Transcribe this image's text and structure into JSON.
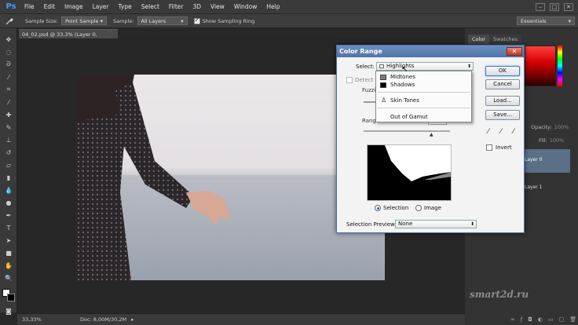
{
  "app": {
    "logo": "Ps",
    "menu": [
      "File",
      "Edit",
      "Image",
      "Layer",
      "Type",
      "Select",
      "Filter",
      "3D",
      "View",
      "Window",
      "Help"
    ],
    "window_controls": [
      "–",
      "□",
      "✕"
    ]
  },
  "options_bar": {
    "sample_size_label": "Sample Size:",
    "sample_size_value": "Point Sample",
    "sample_label": "Sample:",
    "sample_value": "All Layers",
    "sampling_ring_label": "Show Sampling Ring",
    "sampling_ring_checked": true,
    "workspace_value": "Essentials"
  },
  "document": {
    "tab_title": "04_02.psd @ 33,3% (Layer 0, RGB/8#) *",
    "tab_close": "×"
  },
  "status_bar": {
    "zoom": "33,33%",
    "doc_size": "Doc: 8,00M/30,2M"
  },
  "panels": {
    "tabs": [
      {
        "label": "Color",
        "active": true
      },
      {
        "label": "Swatches",
        "active": false
      }
    ],
    "opacity_label": "Opacity:",
    "opacity_value": "100%",
    "fill_label": "Fill:",
    "fill_value": "100%",
    "layers": [
      "Layer 0",
      "Layer 1"
    ]
  },
  "color_range": {
    "title": "Color Range",
    "close_glyph": "✕",
    "select_label": "Select:",
    "select_value": "Highlights",
    "detect_faces_label": "Detect F",
    "fuzziness_label": "Fuzzi",
    "range_label": "Range:",
    "range_value": "190",
    "selection_radio": "Selection",
    "image_radio": "Image",
    "selection_selected": true,
    "selection_preview_label": "Selection Preview:",
    "selection_preview_value": "None",
    "ok": "OK",
    "cancel": "Cancel",
    "load": "Load...",
    "save": "Save...",
    "invert_label": "Invert",
    "invert_checked": false,
    "dropdown": {
      "items": [
        {
          "label": "Midtones",
          "swatch": "#7a7a7a"
        },
        {
          "label": "Shadows",
          "swatch": "#000000"
        },
        {
          "label": "Skin Tones",
          "swatch": ""
        },
        {
          "label": "Out of Gamut",
          "swatch": ""
        }
      ]
    }
  },
  "watermark": "smart2d.ru"
}
